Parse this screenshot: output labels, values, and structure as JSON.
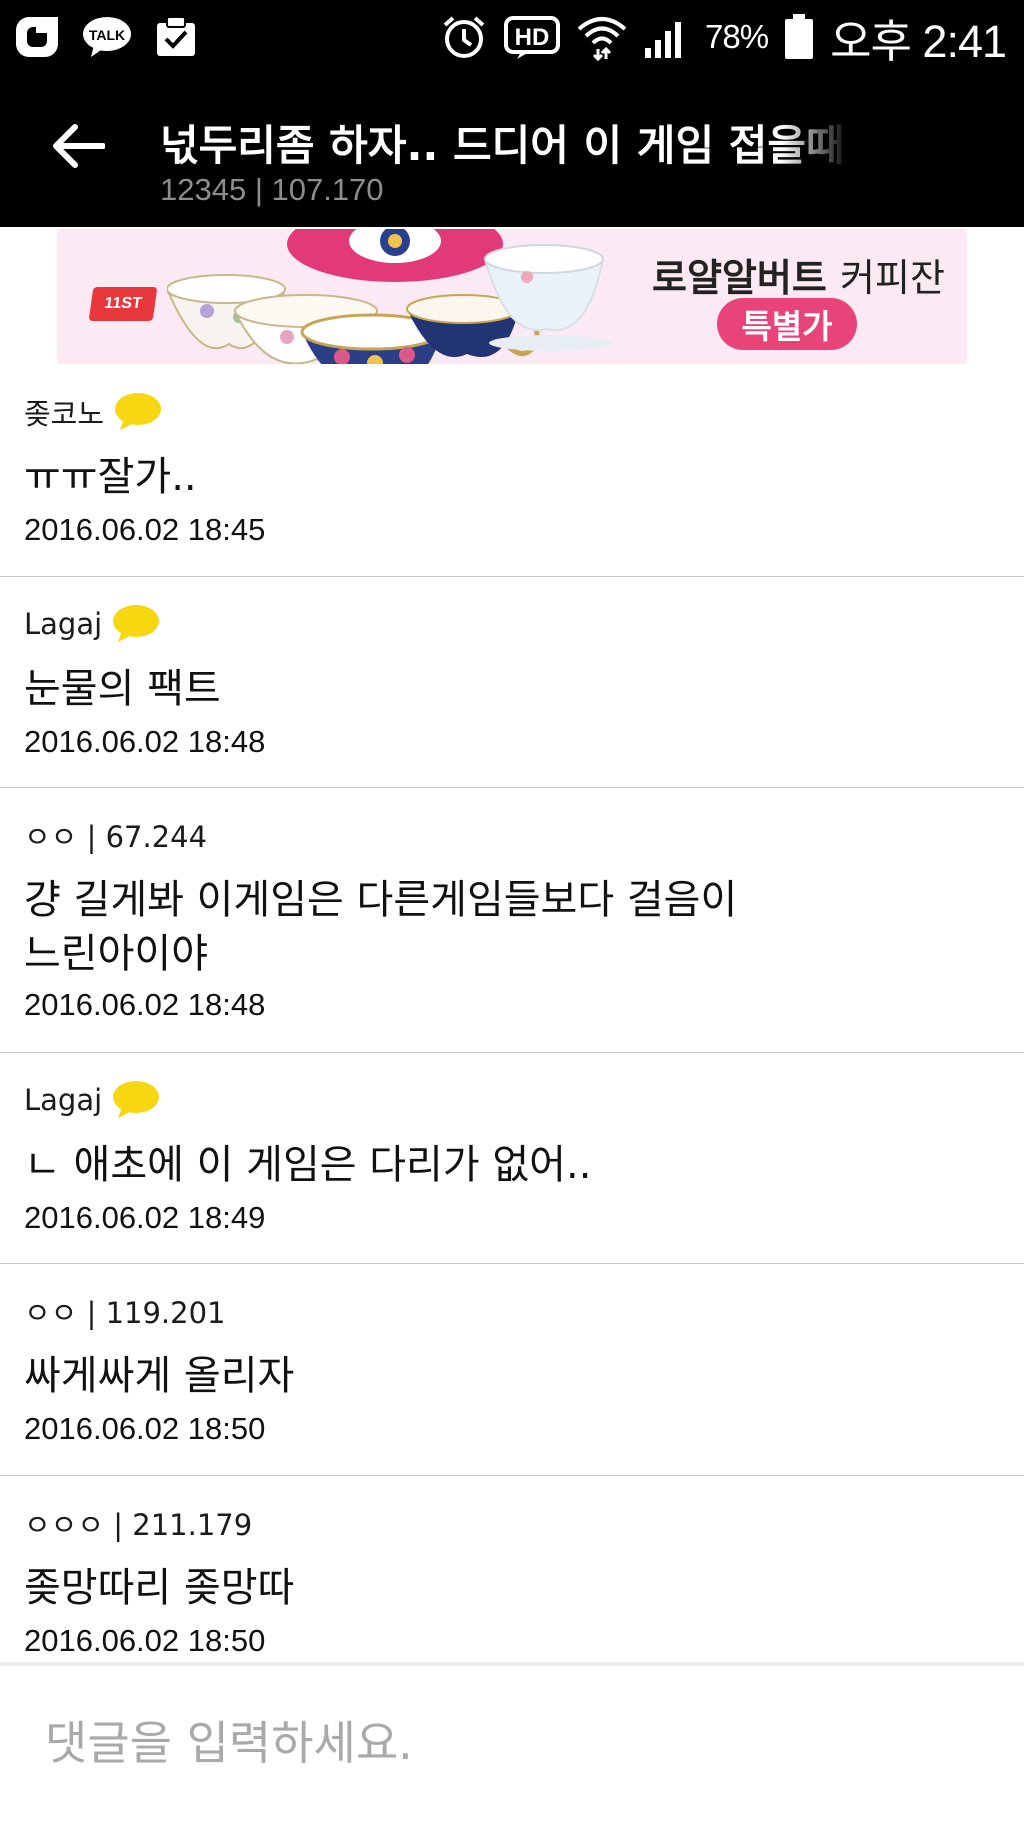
{
  "status_bar": {
    "battery_percent": "78%",
    "time": "오후 2:41",
    "icons": [
      "naver-o-icon",
      "kakaotalk-icon",
      "clipboard-check-icon",
      "alarm-icon",
      "hd-icon",
      "wifi-icon",
      "signal-icon",
      "battery-icon"
    ]
  },
  "header": {
    "title": "넋두리좀 하자.. 드디어 이 게임 접을때",
    "meta": "12345 | 107.170",
    "back_icon": "back-arrow-icon"
  },
  "ad": {
    "brand_badge": "11ST",
    "title_bold": "로얄알버트",
    "title_light": "커피잔",
    "button_label": "특별가",
    "colors": {
      "background": "#fbeaf3",
      "button": "#e8447a",
      "badge": "#e8383d"
    }
  },
  "comments": [
    {
      "author": "좆코노",
      "has_icon": true,
      "text": "ㅠㅠ잘가..",
      "date": "2016.06.02 18:45"
    },
    {
      "author": "Lagaj",
      "has_icon": true,
      "text": "눈물의 팩트",
      "date": "2016.06.02 18:48"
    },
    {
      "author": "ㅇㅇ | 67.244",
      "has_icon": false,
      "text": "걍 길게봐 이게임은 다른게임들보다 걸음이\n느린아이야",
      "date": "2016.06.02 18:48"
    },
    {
      "author": "Lagaj",
      "has_icon": true,
      "text": "ㄴ 애초에 이 게임은 다리가 없어..",
      "date": "2016.06.02 18:49"
    },
    {
      "author": "ㅇㅇ | 119.201",
      "has_icon": false,
      "text": "싸게싸게 올리자",
      "date": "2016.06.02 18:50"
    },
    {
      "author": "ㅇㅇㅇ | 211.179",
      "has_icon": false,
      "text": "좆망따리 좆망따",
      "date": "2016.06.02 18:50"
    }
  ],
  "input": {
    "placeholder": "댓글을 입력하세요."
  },
  "colors": {
    "header_bg": "#000000",
    "speech_icon": "#f7d711",
    "divider": "#c9c9c9",
    "meta_text": "#8d8d8d"
  }
}
